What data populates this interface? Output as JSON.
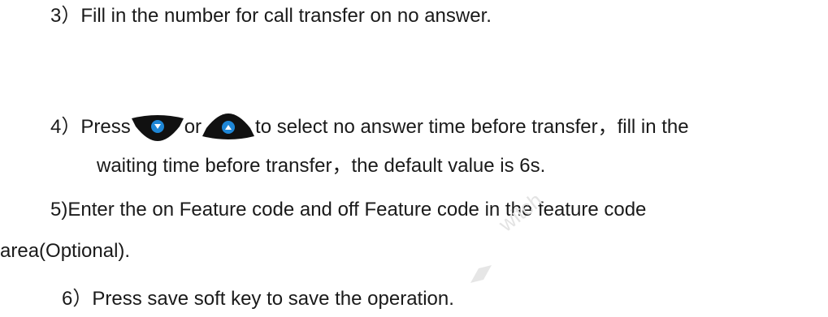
{
  "document": {
    "step3": "3）Fill in the number for    call transfer on no answer.",
    "step4": {
      "prefix": "4）Press",
      "down_key_icon": "down-arrow-key",
      "middle": "or",
      "up_key_icon": "up-arrow-key",
      "suffix": "to select no answer time before transfer，fill in the"
    },
    "step4_continued": "waiting time before transfer，the default value is 6s.",
    "step5_line1": "5)Enter the on Feature code and off Feature code in the feature code",
    "step5_line2": "area(Optional).",
    "step6": "6）Press save soft key to save the operation."
  },
  "watermark": {
    "text": "witch",
    "color": "#e3e3e3"
  },
  "colors": {
    "text": "#1a1a1a",
    "key_body": "#111111",
    "key_button": "#1e86d6"
  }
}
